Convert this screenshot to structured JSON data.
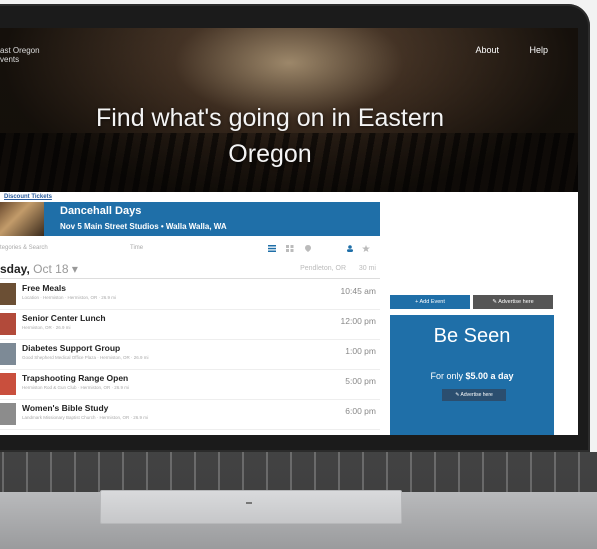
{
  "site": {
    "brand": "ast Oregon\nvents",
    "nav": [
      "About",
      "Help"
    ],
    "hero_title": "Find what's going on in Eastern Oregon"
  },
  "featured": {
    "link": "Discount Tickets",
    "name": "Dancehall Days",
    "meta": "Nov 5   Main Street Studios   •  Walla Walla, WA"
  },
  "toolbar": {
    "search": "tegories & Search",
    "time": "Time"
  },
  "day": {
    "title": "sday,",
    "date": "Oct 18",
    "location": "Pendleton, OR",
    "radius": "30 mi"
  },
  "events": [
    {
      "title": "Free Meals",
      "sub": "Location · Hermiston · Hermiston, OR · 26.9 mi",
      "time": "10:45 am"
    },
    {
      "title": "Senior Center Lunch",
      "sub": "Hermiston, OR · 26.9 mi",
      "time": "12:00 pm"
    },
    {
      "title": "Diabetes Support Group",
      "sub": "Good Shepherd Medical Office Plaza · Hermiston, OR · 26.9 mi",
      "time": "1:00 pm"
    },
    {
      "title": "Trapshooting Range Open",
      "sub": "Hermiston Rod & Gun Club · Hermiston, OR · 26.9 mi",
      "time": "5:00 pm"
    },
    {
      "title": "Women's Bible Study",
      "sub": "Landmark Missionary Baptist Church · Hermiston, OR · 26.9 mi",
      "time": "6:00 pm"
    }
  ],
  "side": {
    "add_event": "+ Add Event",
    "advertise": "Advertise here",
    "heading": "Be Seen",
    "offer_prefix": "For only ",
    "offer_price": "$5.00 a day",
    "cta": "Advertise here"
  },
  "colors": {
    "accent": "#1f6fa8"
  }
}
